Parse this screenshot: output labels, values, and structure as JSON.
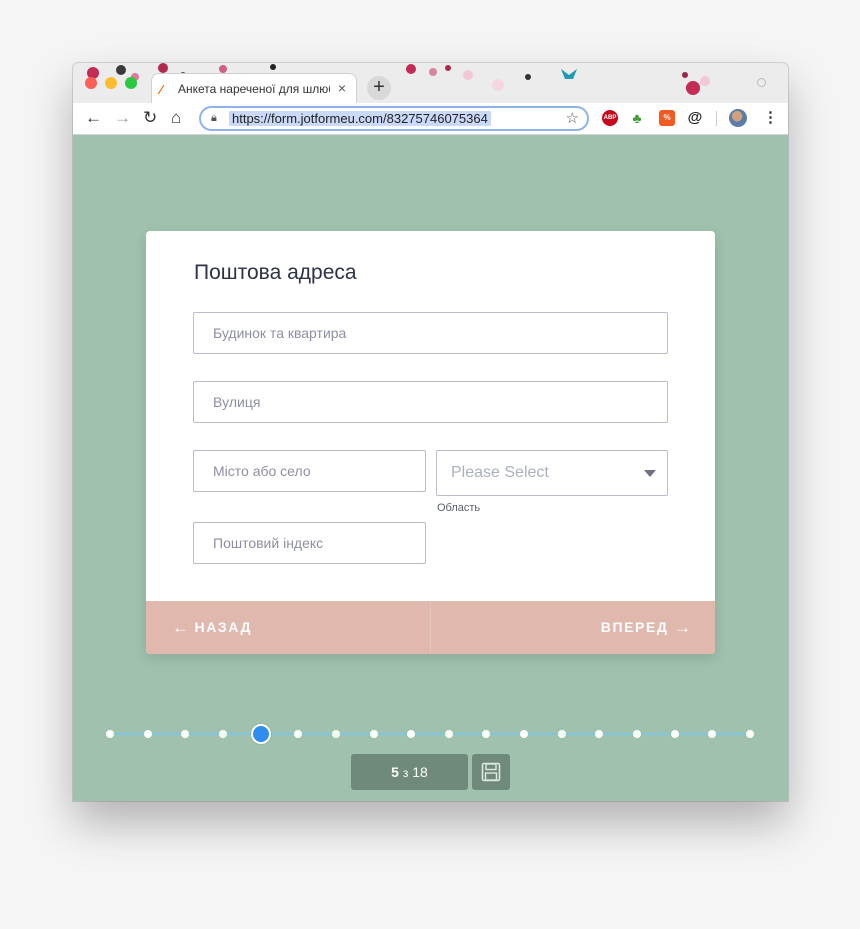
{
  "browser": {
    "tab_title": "Анкета нареченої для шлюбн",
    "tab_close": "×",
    "new_tab": "+",
    "url": "https://form.jotformeu.com/83275746075364",
    "ext_abp": "ABP",
    "ext_pct": "%",
    "ext_at": "@",
    "menu": "⋮"
  },
  "form": {
    "title": "Поштова адреса",
    "house_placeholder": "Будинок та квартира",
    "street_placeholder": "Вулиця",
    "city_placeholder": "Місто або село",
    "region_select": "Please Select",
    "region_label": "Область",
    "zip_placeholder": "Поштовий індекс",
    "back_label": "НАЗАД",
    "next_label": "ВПЕРЕД"
  },
  "progress": {
    "current": "5",
    "of_text": "з",
    "total": "18",
    "steps": 18,
    "current_index": 5
  },
  "colors": {
    "page_bg": "#9fc1ad",
    "footer_bg": "#e0b8ad",
    "accent_blue": "#2f8df0",
    "counter_bg": "#6f8a7a"
  }
}
